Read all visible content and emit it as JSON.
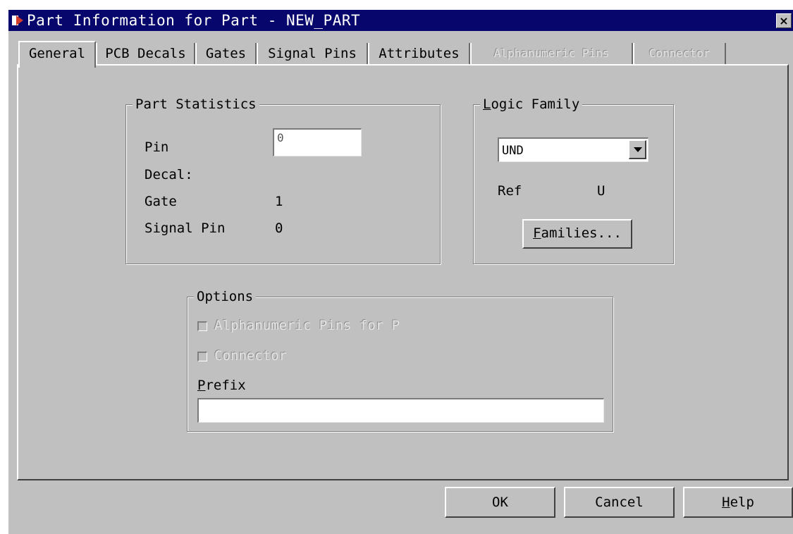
{
  "window": {
    "title": "Part Information for Part - NEW_PART",
    "close_glyph": "×"
  },
  "tabs": [
    {
      "label": "General",
      "active": true,
      "enabled": true
    },
    {
      "label": "PCB Decals",
      "active": false,
      "enabled": true
    },
    {
      "label": "Gates",
      "active": false,
      "enabled": true
    },
    {
      "label": "Signal Pins",
      "active": false,
      "enabled": true
    },
    {
      "label": "Attributes",
      "active": false,
      "enabled": true
    },
    {
      "label": "Alphanumeric Pins",
      "active": false,
      "enabled": false
    },
    {
      "label": "Connector",
      "active": false,
      "enabled": false
    }
  ],
  "part_statistics": {
    "title": "Part Statistics",
    "pin_label": "Pin",
    "pin_value": "0",
    "decal_label": "Decal:",
    "gate_label": "Gate",
    "gate_value": "1",
    "signal_pin_label": "Signal Pin",
    "signal_pin_value": "0"
  },
  "logic_family": {
    "title_first": "L",
    "title_rest": "ogic Family",
    "selected": "UND",
    "ref_label": "Ref",
    "ref_value": "U",
    "families_first": "F",
    "families_rest": "amilies..."
  },
  "options": {
    "title": "Options",
    "alphanumeric_label": "Alphanumeric Pins for P",
    "connector_label": "Connector",
    "prefix_first": "P",
    "prefix_rest": "refix",
    "prefix_value": ""
  },
  "buttons": {
    "ok": "OK",
    "cancel": "Cancel",
    "help_first": "H",
    "help_rest": "elp"
  },
  "colors": {
    "titlebar": "#06066c",
    "dialog_bg": "#c0c0c0",
    "disabled_text": "#e4e4e4"
  },
  "icons": {
    "app": "app-icon",
    "close": "close-icon",
    "dropdown": "chevron-down-icon"
  }
}
